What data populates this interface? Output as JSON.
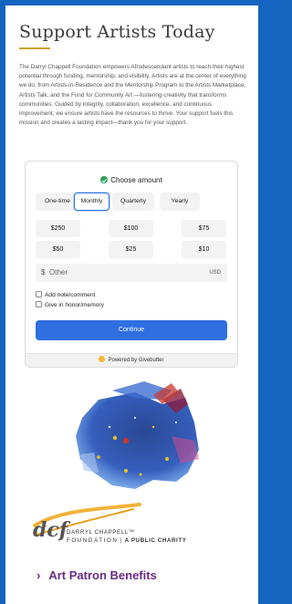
{
  "heading": {
    "title": "Support Artists Today",
    "intro": "The Darryl Chappell Foundation empowers Afrodescendant artists to reach their highest potential through funding, mentorship, and visibility. Artists are at the center of everything we do, from Artists-in-Residence and the Mentorship Program to the Artists Marketplace, Artists Talk, and the Fund for Community Art —fostering creativity that transforms communities. Guided by integrity, collaboration, excellence, and continuous improvement, we ensure artists have the resources to thrive. Your support fuels this mission and creates a lasting impact—thank you for your support."
  },
  "donation": {
    "choose_label": "Choose amount",
    "frequencies": [
      "One-time",
      "Monthly",
      "Quarterly",
      "Yearly"
    ],
    "selected_frequency": "Monthly",
    "amounts": [
      "$250",
      "$100",
      "$75",
      "$50",
      "$25",
      "$10"
    ],
    "other": {
      "currency_symbol": "$",
      "placeholder": "Other",
      "currency": "USD"
    },
    "options": [
      "Add note/comment",
      "Give in honor/memory"
    ],
    "continue_label": "Continue",
    "powered_by": "Powered by Givebutter"
  },
  "logo": {
    "name": "DARRYL CHAPPELL",
    "tm": "™",
    "line2": "FOUNDATION",
    "separator": "|",
    "tagline": "A PUBLIC CHARITY",
    "monogram": "dcf"
  },
  "link": {
    "chevron": "›",
    "label": "Art Patron Benefits"
  },
  "colors": {
    "page_border": "#1565c0",
    "accent_blue": "#2f6fe0",
    "heading_rule": "#c9a227",
    "link_purple": "#6a2a85"
  },
  "icons": {
    "choose": "shield-check-icon",
    "powered": "givebutter-icon"
  }
}
